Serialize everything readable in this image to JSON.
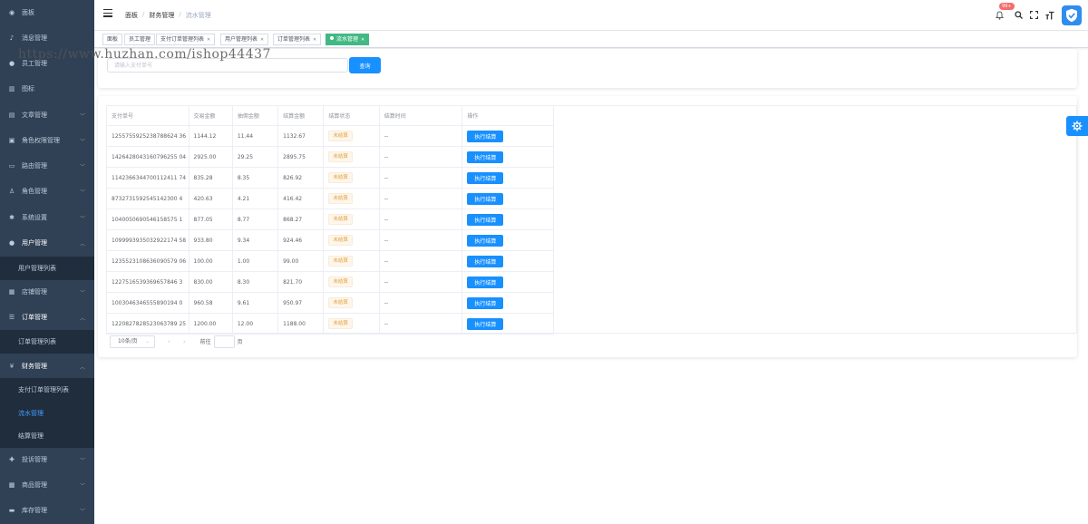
{
  "sidebar": {
    "items": [
      {
        "label": "面板",
        "icon": "dashboard-icon",
        "glyph": "◉"
      },
      {
        "label": "消息管理",
        "icon": "bell-icon",
        "glyph": "♪"
      },
      {
        "label": "员工管理",
        "icon": "user-icon",
        "glyph": "●"
      },
      {
        "label": "图标",
        "icon": "grid-icon",
        "glyph": "▥"
      },
      {
        "label": "文章管理",
        "icon": "document-icon",
        "glyph": "▤"
      },
      {
        "label": "角色权限管理",
        "icon": "lock-icon",
        "glyph": "▣"
      },
      {
        "label": "路由管理",
        "icon": "folder-icon",
        "glyph": "▭"
      },
      {
        "label": "角色管理",
        "icon": "person-icon",
        "glyph": "♙"
      },
      {
        "label": "系统设置",
        "icon": "gear-icon",
        "glyph": "✱"
      },
      {
        "label": "用户管理",
        "icon": "user-icon",
        "glyph": "●"
      },
      {
        "label": "用户管理列表",
        "sub": true
      },
      {
        "label": "店铺管理",
        "icon": "shop-icon",
        "glyph": "▦"
      },
      {
        "label": "订单管理",
        "icon": "list-icon",
        "glyph": "☰"
      },
      {
        "label": "订单管理列表",
        "sub": true
      },
      {
        "label": "财务管理",
        "icon": "yen-icon",
        "glyph": "¥"
      },
      {
        "label": "支付订单管理列表",
        "sub": true
      },
      {
        "label": "流水管理",
        "sub": true,
        "active": true
      },
      {
        "label": "结算管理",
        "sub": true
      },
      {
        "label": "投诉管理",
        "icon": "complaint-icon",
        "glyph": "✚"
      },
      {
        "label": "商品管理",
        "icon": "goods-icon",
        "glyph": "▩"
      },
      {
        "label": "库存管理",
        "icon": "stock-icon",
        "glyph": "▬"
      }
    ]
  },
  "breadcrumb": [
    "面板",
    "财务管理",
    "流水管理"
  ],
  "navbar": {
    "badge": "99+"
  },
  "tags": [
    "面板",
    "员工管理",
    "支付订单管理列表",
    "用户管理列表",
    "订单管理列表",
    "流水管理"
  ],
  "watermark": "https://www.huzhan.com/ishop44437",
  "search": {
    "placeholder": "请输入支付单号",
    "button": "查询"
  },
  "table": {
    "headers": [
      "支付单号",
      "交易金额",
      "抽佣金额",
      "结算金额",
      "结算状态",
      "结算时间",
      "操作"
    ],
    "status_text": "未结算",
    "time_text": "--",
    "action_label": "执行结算",
    "rows": [
      [
        "1255755925238788624 36",
        "1144.12",
        "11.44",
        "1132.67"
      ],
      [
        "1426428043160796255 04",
        "2925.00",
        "29.25",
        "2895.75"
      ],
      [
        "1142366344700112411 74",
        "835.28",
        "8.35",
        "826.92"
      ],
      [
        "8732731592545142300 4",
        "420.63",
        "4.21",
        "416.42"
      ],
      [
        "1040050690546158575 1",
        "877.05",
        "8.77",
        "868.27"
      ],
      [
        "1099993935032922174 58",
        "933.80",
        "9.34",
        "924.46"
      ],
      [
        "1235523108636090579 06",
        "100.00",
        "1.00",
        "99.00"
      ],
      [
        "1227516539369657846 3",
        "830.00",
        "8.30",
        "821.70"
      ],
      [
        "1003046346555890194 0",
        "960.58",
        "9.61",
        "950.97"
      ],
      [
        "1220827828523063789 25",
        "1200.00",
        "12.00",
        "1188.00"
      ]
    ]
  },
  "pagination": {
    "page_size": "10条/页",
    "goto": "前往",
    "page_unit": "页"
  },
  "colors": {
    "sidebar_bg": "#304156",
    "accent": "#1890ff",
    "active_tag": "#42b983",
    "status_warning": "#e6a23c",
    "badge": "#f56c6c"
  }
}
